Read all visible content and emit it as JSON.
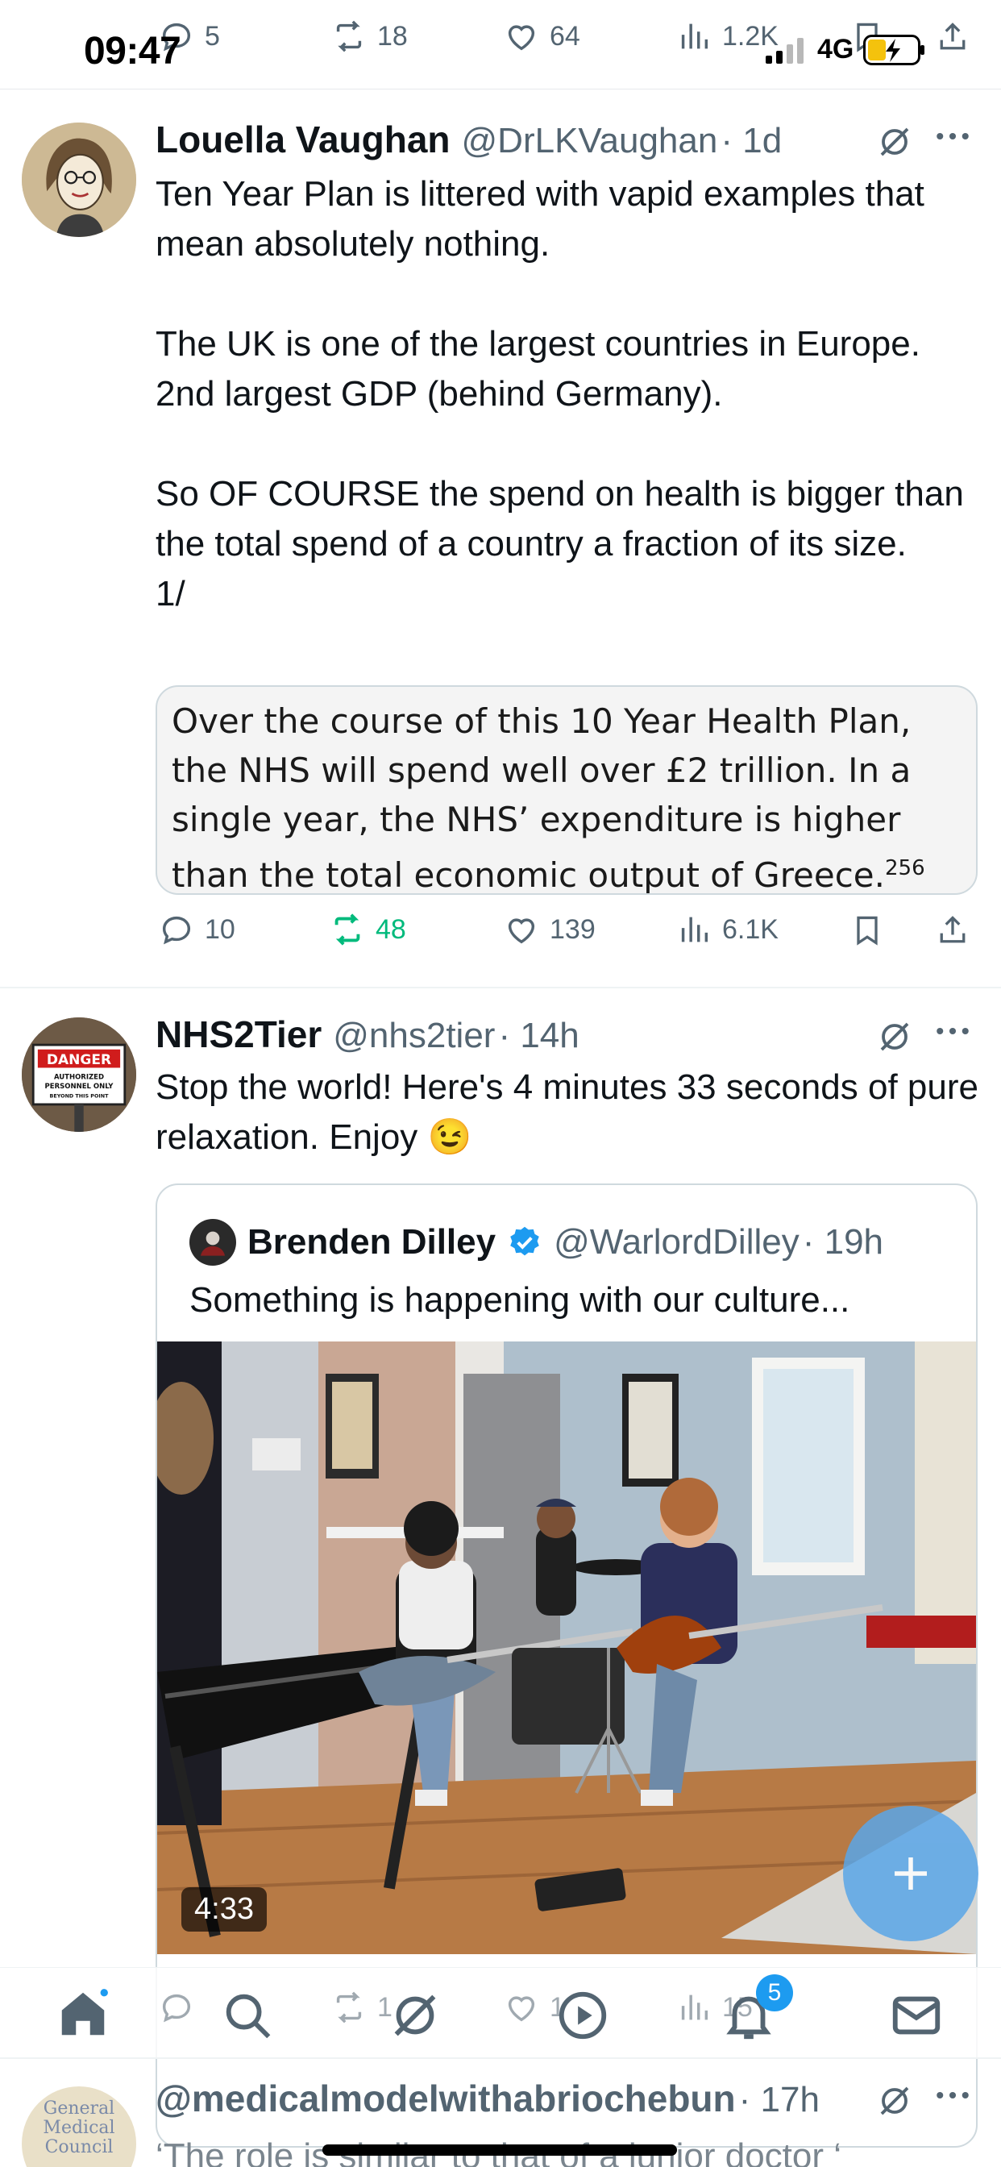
{
  "status_bar": {
    "time": "09:47",
    "network": "4G"
  },
  "prev_tweet_actions": {
    "replies": "5",
    "reposts": "18",
    "likes": "64",
    "views": "1.2K"
  },
  "tweet1": {
    "name": "Louella Vaughan",
    "handle": "@DrLKVaughan",
    "time": "· 1d",
    "text": "Ten Year Plan is littered with vapid examples that mean absolutely nothing.\n\nThe UK is one of the largest countries in Europe. 2nd largest GDP (behind Germany).\n\nSo OF COURSE the spend on health is bigger than the total spend of a country a fraction of its size.\n1/",
    "image_text": "Over the course of this 10 Year Health Plan, the NHS will spend well over £2 trillion. In a single year, the NHS’ expenditure is higher than the total economic output of Greece.",
    "image_footnote": "256",
    "actions": {
      "replies": "10",
      "reposts": "48",
      "likes": "139",
      "views": "6.1K"
    }
  },
  "tweet2": {
    "name": "NHS2Tier",
    "handle": "@nhs2tier",
    "time": "· 14h",
    "text": "Stop the world! Here's 4 minutes 33 seconds of pure relaxation. Enjoy 😉",
    "avatar_sign": {
      "line1": "DANGER",
      "line2": "AUTHORIZED",
      "line3": "PERSONNEL ONLY",
      "line4": "BEYOND THIS POINT"
    },
    "quote": {
      "name": "Brenden Dilley",
      "handle": "@WarlordDilley",
      "time": "· 19h",
      "text": "Something is happening with our culture...",
      "video_duration": "4:33"
    },
    "actions_partial": {
      "replies": "",
      "reposts": "1",
      "likes": "1",
      "views": "15"
    }
  },
  "tweet3": {
    "handle": "@medicalmodelwithabriochebun",
    "time": "· 17h",
    "text": "‘The role is similar to that of a junior doctor ‘",
    "avatar_text": "General Medical Council"
  },
  "nav": {
    "notification_count": "5"
  },
  "colors": {
    "accent": "#1d9bf0",
    "repost_active": "#00ba7c",
    "fab": "#5aa6e8"
  }
}
